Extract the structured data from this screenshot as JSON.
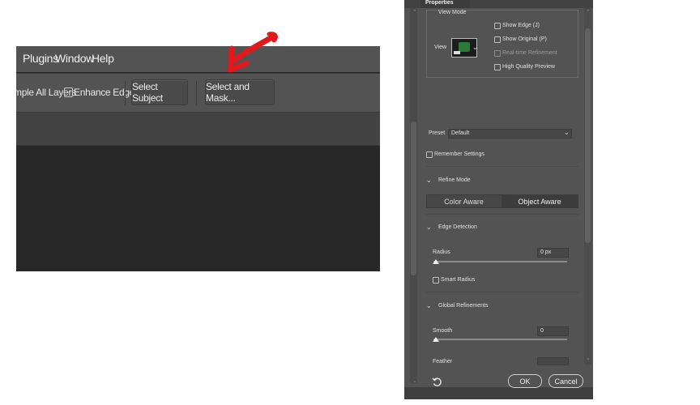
{
  "menubar": {
    "items": [
      "Plugins",
      "Window",
      "Help"
    ]
  },
  "options_bar": {
    "sample_all_layers_label": "mple All Layers",
    "enhance_edge_label": "Enhance Edge",
    "select_subject_label": "Select Subject",
    "select_and_mask_label": "Select and Mask..."
  },
  "annotation": {
    "arrow_color": "#e0191c"
  },
  "properties": {
    "tab_title": "Properties",
    "view_mode": {
      "section_label": "View Mode",
      "view_label": "View",
      "options": [
        {
          "label": "Show Edge (J)",
          "disabled": false
        },
        {
          "label": "Show Original (P)",
          "disabled": false
        },
        {
          "label": "Real-time Refinement",
          "disabled": true
        },
        {
          "label": "High Quality Preview",
          "disabled": false
        }
      ]
    },
    "preset": {
      "label": "Preset",
      "value": "Default"
    },
    "remember_settings_label": "Remember Settings",
    "refine_mode": {
      "section_label": "Refine Mode",
      "options": [
        "Color Aware",
        "Object Aware"
      ],
      "selected": "Object Aware"
    },
    "edge_detection": {
      "section_label": "Edge Detection",
      "radius_label": "Radius",
      "radius_value": "0 px",
      "smart_radius_label": "Smart Radius"
    },
    "global_refinements": {
      "section_label": "Global Refinements",
      "smooth_label": "Smooth",
      "smooth_value": "0",
      "feather_label": "Feather"
    },
    "ok_label": "OK",
    "cancel_label": "Cancel"
  }
}
